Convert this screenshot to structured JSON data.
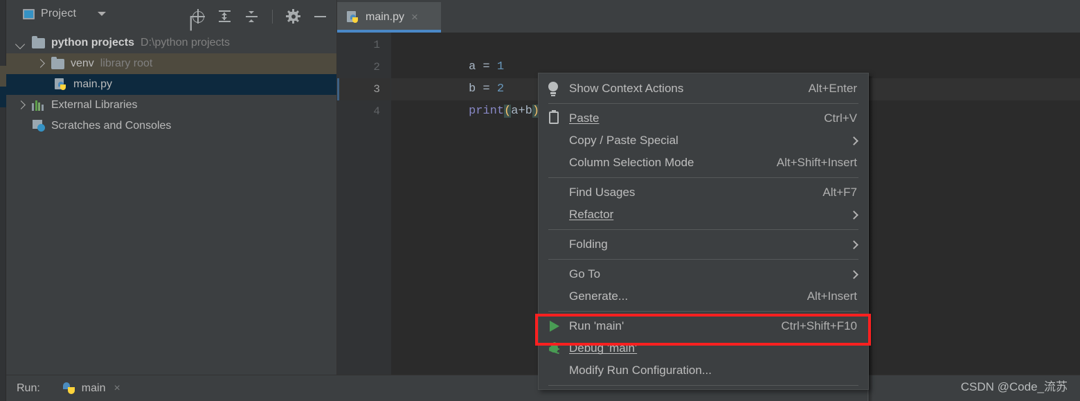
{
  "window": {
    "theme_bg": "#3c3f41",
    "editor_bg": "#2b2b2b",
    "accent": "#4a88c7",
    "highlight_red": "#ff2020"
  },
  "project_panel": {
    "title": "Project",
    "icons": [
      {
        "name": "locate-icon"
      },
      {
        "name": "expand-all-icon"
      },
      {
        "name": "collapse-all-icon"
      },
      {
        "name": "settings-gear-icon"
      },
      {
        "name": "minimize-icon"
      }
    ],
    "tree": [
      {
        "label": "python projects",
        "detail": "D:\\python projects",
        "state": "expanded",
        "icon": "folder-icon"
      },
      {
        "label": "venv",
        "detail": "library root",
        "state": "collapsed",
        "icon": "folder-icon"
      },
      {
        "label": "main.py",
        "detail": "",
        "state": "selected",
        "icon": "python-file-icon"
      },
      {
        "label": "External Libraries",
        "detail": "",
        "state": "collapsed",
        "icon": "libraries-icon"
      },
      {
        "label": "Scratches and Consoles",
        "detail": "",
        "state": "leaf",
        "icon": "scratches-icon"
      }
    ]
  },
  "editor": {
    "tab": {
      "label": "main.py",
      "close": "×",
      "icon": "python-file-icon"
    },
    "line_numbers": [
      "1",
      "2",
      "3",
      "4"
    ],
    "current_line": 3,
    "code": {
      "line1": {
        "var": "a",
        "op": " = ",
        "num": "1"
      },
      "line2": {
        "var": "b",
        "op": " = ",
        "num": "2"
      },
      "line3": {
        "fn": "print",
        "open": "(",
        "args": "a+b",
        "close": ")"
      }
    }
  },
  "context_menu": {
    "groups": [
      {
        "items": [
          {
            "label": "Show Context Actions",
            "shortcut": "Alt+Enter",
            "icon": "lightbulb-icon",
            "mnemonic": "",
            "submenu": false
          }
        ]
      },
      {
        "items": [
          {
            "label": "Paste",
            "shortcut": "Ctrl+V",
            "icon": "clipboard-icon",
            "mnemonic": "P",
            "submenu": false
          },
          {
            "label": "Copy / Paste Special",
            "shortcut": "",
            "icon": "",
            "mnemonic": "",
            "submenu": true
          },
          {
            "label": "Column Selection Mode",
            "shortcut": "Alt+Shift+Insert",
            "icon": "",
            "mnemonic": "M",
            "submenu": false
          }
        ]
      },
      {
        "items": [
          {
            "label": "Find Usages",
            "shortcut": "Alt+F7",
            "icon": "",
            "mnemonic": "U",
            "submenu": false
          },
          {
            "label": "Refactor",
            "shortcut": "",
            "icon": "",
            "mnemonic": "R",
            "submenu": true
          }
        ]
      },
      {
        "items": [
          {
            "label": "Folding",
            "shortcut": "",
            "icon": "",
            "mnemonic": "",
            "submenu": true
          }
        ]
      },
      {
        "items": [
          {
            "label": "Go To",
            "shortcut": "",
            "icon": "",
            "mnemonic": "",
            "submenu": true
          },
          {
            "label": "Generate...",
            "shortcut": "Alt+Insert",
            "icon": "",
            "mnemonic": "",
            "submenu": false
          }
        ]
      },
      {
        "items": [
          {
            "label": "Run 'main'",
            "shortcut": "Ctrl+Shift+F10",
            "icon": "run-icon",
            "mnemonic": "u",
            "submenu": false,
            "highlighted": true
          },
          {
            "label": "Debug 'main'",
            "shortcut": "",
            "icon": "debug-icon",
            "mnemonic": "D",
            "submenu": false
          },
          {
            "label": "Modify Run Configuration...",
            "shortcut": "",
            "icon": "",
            "mnemonic": "",
            "submenu": false
          }
        ]
      }
    ]
  },
  "run_bar": {
    "label": "Run:",
    "config_name": "main",
    "close": "×",
    "icon": "python-icon"
  },
  "watermark": "CSDN @Code_流苏"
}
